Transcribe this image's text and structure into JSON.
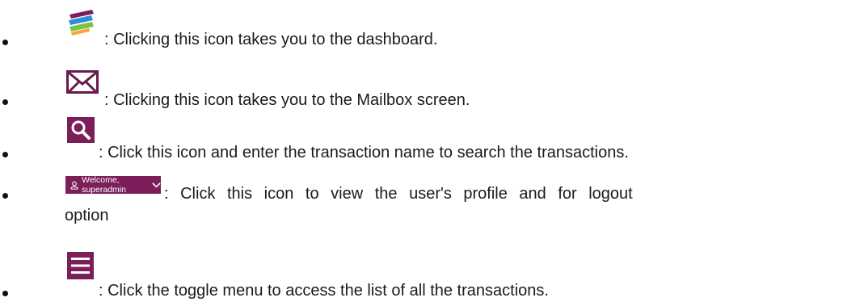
{
  "items": [
    {
      "icon": "dashboard-logo-icon",
      "text": ": Clicking this icon takes you to the dashboard."
    },
    {
      "icon": "mail-icon",
      "text": ": Clicking this icon takes you to the Mailbox screen."
    },
    {
      "icon": "search-icon",
      "text": ": Click this icon and enter the transaction name to search the transactions."
    },
    {
      "icon": "user-welcome-icon",
      "button_label": "Welcome, superadmin",
      "text": ": Click this icon to view the user's profile and for logout",
      "text_line2": "option"
    },
    {
      "icon": "hamburger-menu-icon",
      "text": ": Click the toggle menu to access the list of all the transactions."
    }
  ],
  "colors": {
    "brand": "#7b1e5a",
    "text": "#1a1a1a",
    "mail_icon": "#6a1a4c"
  }
}
